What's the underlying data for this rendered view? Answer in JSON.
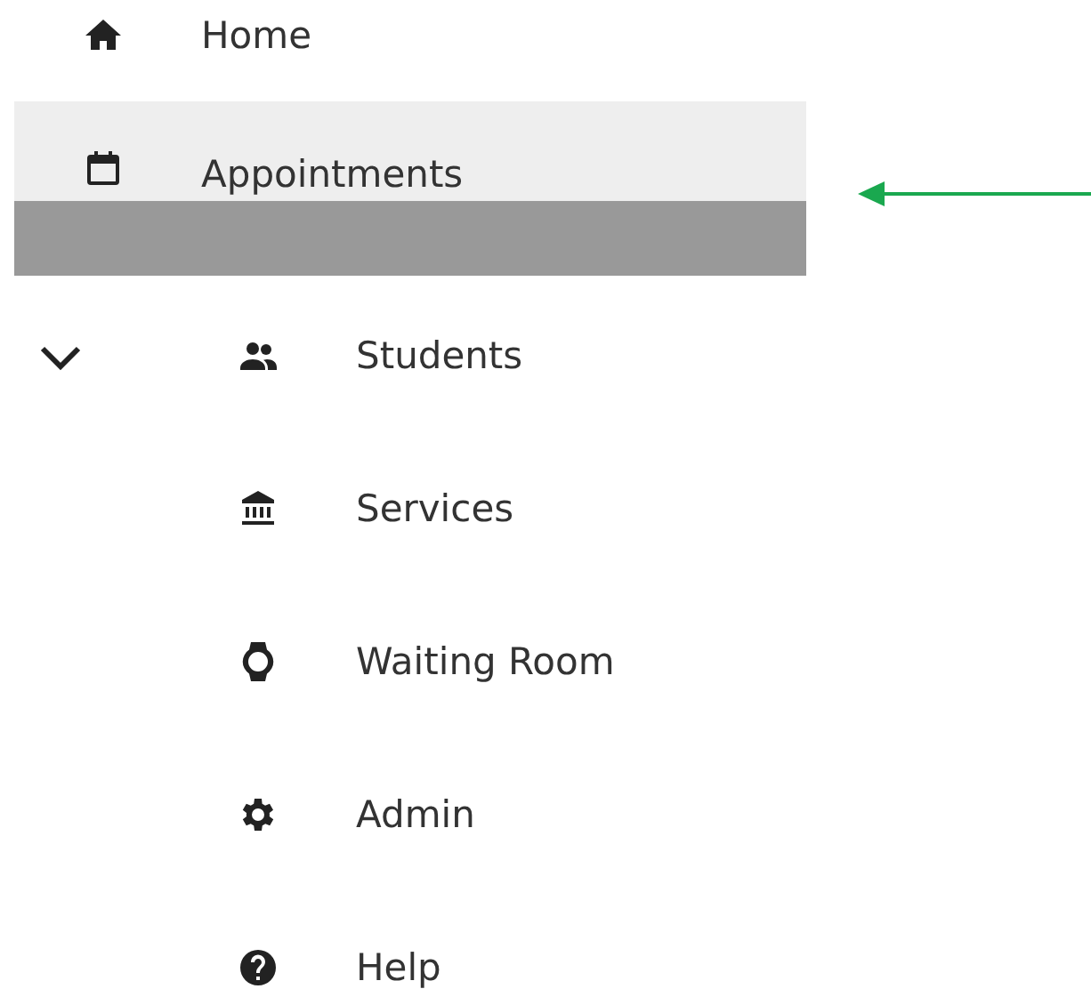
{
  "nav": {
    "items": [
      {
        "kind": "home",
        "label": "Home",
        "selected": false
      },
      {
        "kind": "calendar",
        "label": "Appointments",
        "selected": true
      }
    ],
    "section": {
      "expanded": true,
      "items": [
        {
          "kind": "people",
          "label": "Students",
          "selected": false
        },
        {
          "kind": "bank",
          "label": "Services",
          "selected": false
        },
        {
          "kind": "watch",
          "label": "Waiting Room",
          "selected": false
        },
        {
          "kind": "gear",
          "label": "Admin",
          "selected": false
        },
        {
          "kind": "help",
          "label": "Help",
          "selected": false
        }
      ]
    }
  },
  "annotation": {
    "kind": "arrow",
    "color": "#1aa84f"
  }
}
